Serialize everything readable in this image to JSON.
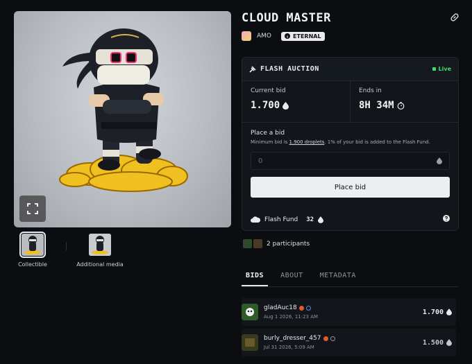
{
  "media": {
    "thumbnails": [
      {
        "label": "Collectible"
      },
      {
        "label": "Additional media"
      }
    ]
  },
  "item": {
    "title": "CLOUD MASTER",
    "creator": "AMO",
    "badge": "ETERNAL"
  },
  "auction": {
    "header": "FLASH AUCTION",
    "status": "Live",
    "current_bid_label": "Current bid",
    "current_bid_value": "1.700",
    "ends_in_label": "Ends in",
    "ends_in_value": "8H 34M",
    "place_bid_heading": "Place a bid",
    "min_bid_prefix": "Minimum bid is ",
    "min_bid_link": "1.900 droplets",
    "min_bid_suffix": ". 1% of your bid is added to the Flash Fund.",
    "input_placeholder": "0",
    "place_bid_button": "Place bid",
    "flash_fund_label": "Flash Fund",
    "flash_fund_value": "32"
  },
  "participants": {
    "text": "2 participants"
  },
  "tabs": [
    "BIDS",
    "ABOUT",
    "METADATA"
  ],
  "bids": [
    {
      "user": "gladAuc18",
      "date": "Aug 1 2026, 11:23 AM",
      "amount": "1.700"
    },
    {
      "user": "burly_dresser_457",
      "date": "Jul 31 2026, 5:09 AM",
      "amount": "1.500"
    }
  ],
  "colors": {
    "background": "#0b0d10",
    "panel": "#12151a",
    "live_green": "#3ddc6b",
    "verified_orange": "#e25c2a"
  }
}
